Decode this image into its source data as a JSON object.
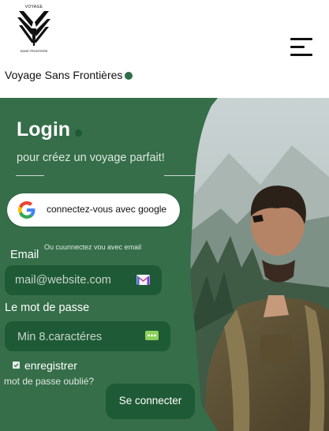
{
  "header": {
    "logo_top_text": "VOYAGE",
    "logo_bottom_text": "SANS FRONTIERE",
    "brand_name": "Voyage Sans Frontières",
    "menu_icon": "hamburger-menu-icon"
  },
  "login": {
    "title": "Login",
    "subtitle": "pour créez un voyage parfait!",
    "google_button_label": "connectez-vous avec google",
    "email_hint": "Ou cuunnectez vou avec email",
    "email_label": "Email",
    "email_placeholder": "mail@website.com",
    "password_label": "Le mot de passe",
    "password_placeholder": "Min 8.caractéres",
    "remember_label": "enregistrer",
    "forgot_label": "mot de passe oublié?",
    "submit_label": "Se connecter"
  },
  "colors": {
    "panel_green": "#356e49",
    "field_green": "#1f5a36",
    "accent_dot": "#2f6e48"
  }
}
